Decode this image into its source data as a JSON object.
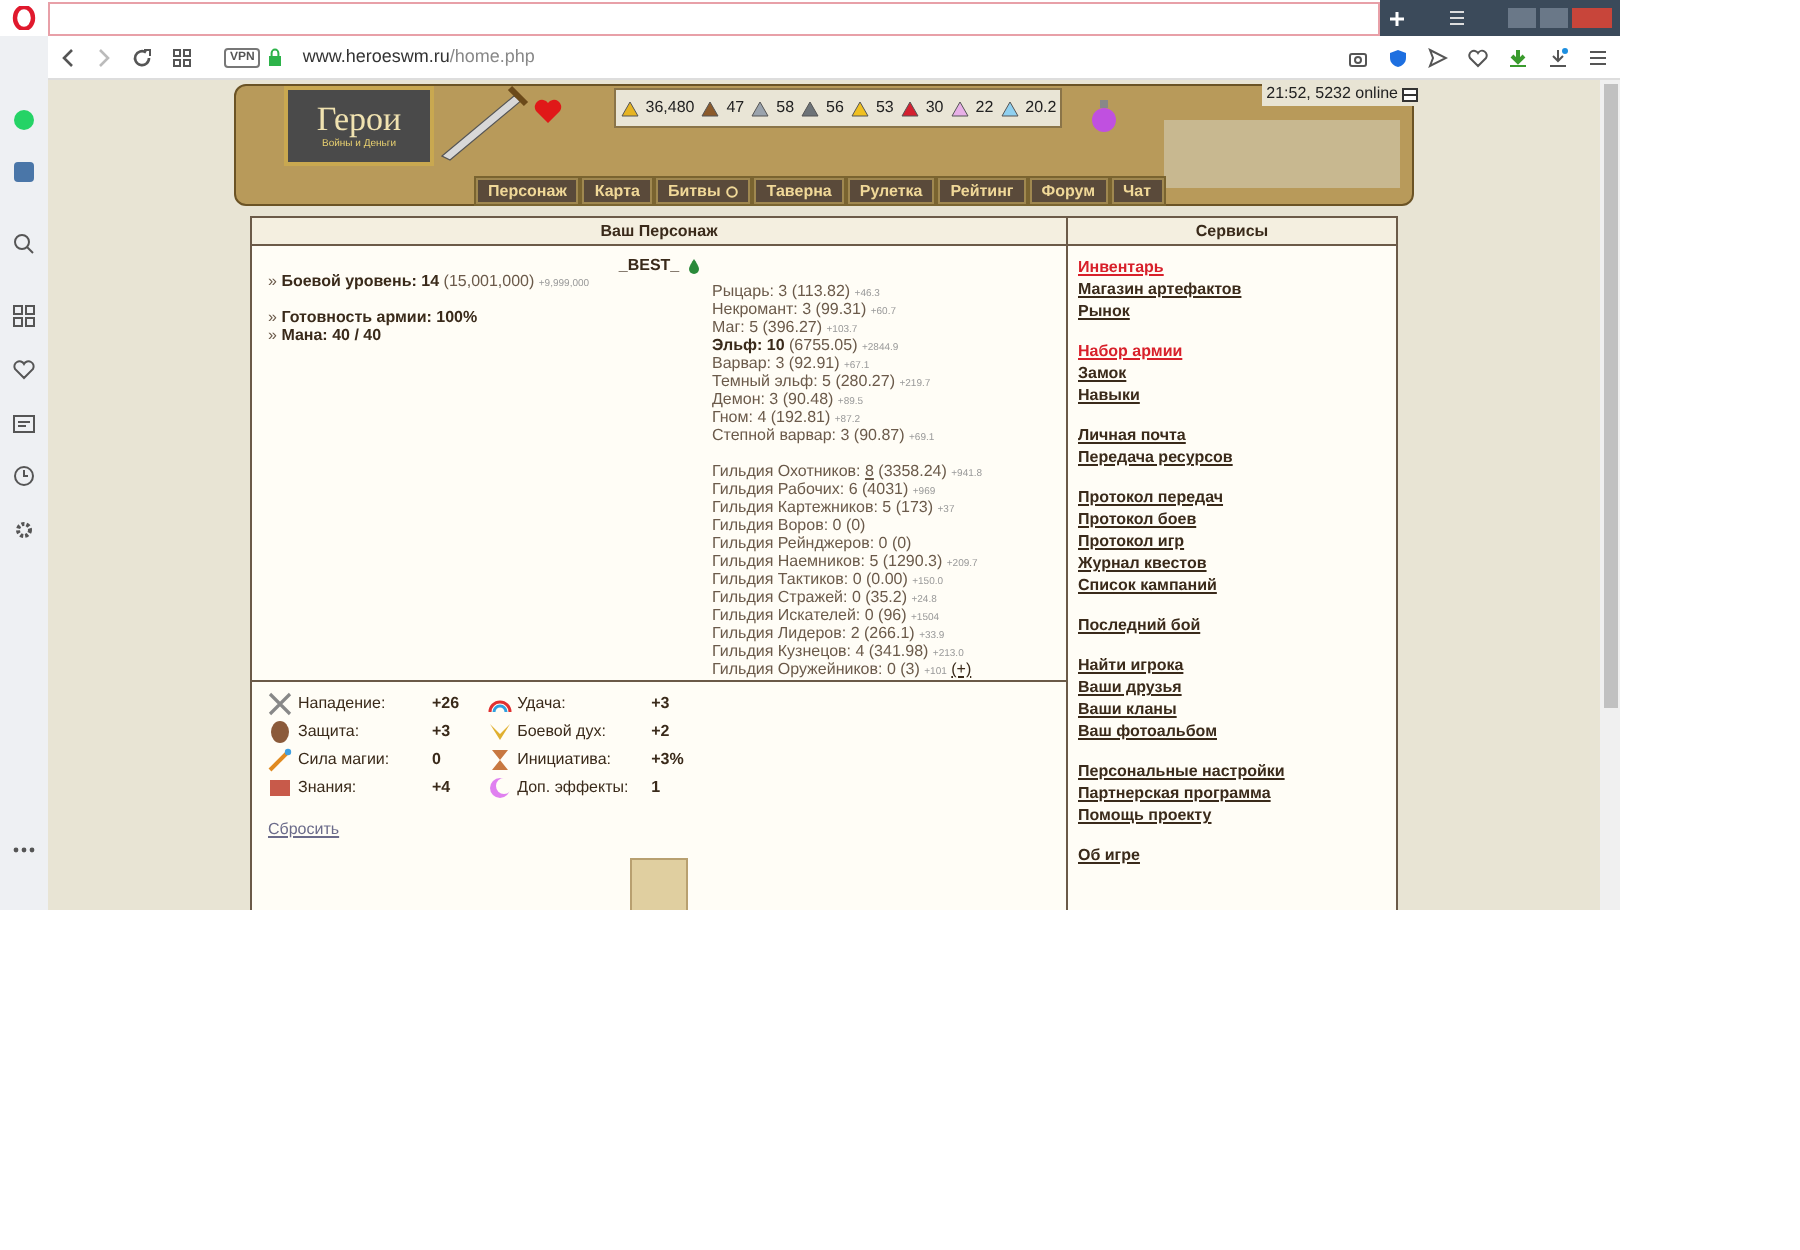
{
  "browser": {
    "vpn": "VPN",
    "url_host": "www.heroeswm.ru",
    "url_path": "/home.php"
  },
  "header": {
    "logo_title": "Герои",
    "logo_subtitle": "Войны и Деньги",
    "resources": [
      "36,480",
      "47",
      "58",
      "56",
      "53",
      "30",
      "22",
      "20.2"
    ],
    "status": "21:52, 5232 online",
    "nav": [
      {
        "label": "Персонаж"
      },
      {
        "label": "Карта"
      },
      {
        "label": "Битвы",
        "badge": true
      },
      {
        "label": "Таверна"
      },
      {
        "label": "Рулетка"
      },
      {
        "label": "Рейтинг"
      },
      {
        "label": "Форум"
      },
      {
        "label": "Чат"
      }
    ]
  },
  "character": {
    "heading": "Ваш Персонаж",
    "name": "_BEST_",
    "stat_groups": [
      [
        {
          "marker": "»",
          "label": "Боевой уровень:",
          "value": "14",
          "detail": "(15,001,000)",
          "delta": "+9,999,000"
        }
      ],
      [
        {
          "marker": "»",
          "label": "Готовность армии:",
          "value": "100%"
        },
        {
          "marker": "»",
          "label": "Мана:",
          "value": "40 / 40"
        }
      ]
    ],
    "factions": [
      {
        "label": "Рыцарь:",
        "value": "3 (113.82)",
        "delta": "+46.3",
        "active": false
      },
      {
        "label": "Некромант:",
        "value": "3 (99.31)",
        "delta": "+60.7",
        "active": false
      },
      {
        "label": "Маг:",
        "value": "5 (396.27)",
        "delta": "+103.7",
        "active": false
      },
      {
        "label": "Эльф:",
        "value": "10",
        "detail": "(6755.05)",
        "delta": "+2844.9",
        "active": true
      },
      {
        "label": "Варвар:",
        "value": "3 (92.91)",
        "delta": "+67.1",
        "active": false
      },
      {
        "label": "Темный эльф:",
        "value": "5 (280.27)",
        "delta": "+219.7",
        "active": false
      },
      {
        "label": "Демон:",
        "value": "3 (90.48)",
        "delta": "+89.5",
        "active": false
      },
      {
        "label": "Гном:",
        "value": "4 (192.81)",
        "delta": "+87.2",
        "active": false
      },
      {
        "label": "Степной варвар:",
        "value": "3 (90.87)",
        "delta": "+69.1",
        "active": false
      }
    ],
    "guilds": [
      {
        "label": "Гильдия Охотников:",
        "level": "8",
        "score": "(3358.24)",
        "delta": "+941.8",
        "link": true
      },
      {
        "label": "Гильдия Рабочих:",
        "level": "6",
        "score": "(4031)",
        "delta": "+969"
      },
      {
        "label": "Гильдия Картежников:",
        "level": "5",
        "score": "(173)",
        "delta": "+37"
      },
      {
        "label": "Гильдия Воров:",
        "level": "0",
        "score": "(0)"
      },
      {
        "label": "Гильдия Рейнджеров:",
        "level": "0",
        "score": "(0)"
      },
      {
        "label": "Гильдия Наемников:",
        "level": "5",
        "score": "(1290.3)",
        "delta": "+209.7"
      },
      {
        "label": "Гильдия Тактиков:",
        "level": "0",
        "score": "(0.00)",
        "delta": "+150.0"
      },
      {
        "label": "Гильдия Стражей:",
        "level": "0",
        "score": "(35.2)",
        "delta": "+24.8"
      },
      {
        "label": "Гильдия Искателей:",
        "level": "0",
        "score": "(96)",
        "delta": "+1504"
      },
      {
        "label": "Гильдия Лидеров:",
        "level": "2",
        "score": "(266.1)",
        "delta": "+33.9"
      },
      {
        "label": "Гильдия Кузнецов:",
        "level": "4",
        "score": "(341.98)",
        "delta": "+213.0"
      },
      {
        "label": "Гильдия Оружейников:",
        "level": "0",
        "score": "(3)",
        "delta": "+101",
        "action": "(+)"
      }
    ],
    "attributes": [
      {
        "label": "Нападение:",
        "value": "+26"
      },
      {
        "label": "Защита:",
        "value": "+3"
      },
      {
        "label": "Сила магии:",
        "value": "0"
      },
      {
        "label": "Знания:",
        "value": "+4"
      },
      {
        "label": "Удача:",
        "value": "+3"
      },
      {
        "label": "Боевой дух:",
        "value": "+2"
      },
      {
        "label": "Инициатива:",
        "value": "+3%"
      },
      {
        "label": "Доп. эффекты:",
        "value": "1"
      }
    ],
    "reset": "Сбросить"
  },
  "services": {
    "heading": "Сервисы",
    "groups": [
      [
        {
          "label": "Инвентарь",
          "highlighted": true
        },
        {
          "label": "Магазин артефактов",
          "highlighted": false
        },
        {
          "label": "Рынок",
          "highlighted": false
        }
      ],
      [
        {
          "label": "Набор армии",
          "highlighted": true
        },
        {
          "label": "Замок",
          "highlighted": false
        },
        {
          "label": "Навыки",
          "highlighted": false
        }
      ],
      [
        {
          "label": "Личная почта",
          "highlighted": false
        },
        {
          "label": "Передача ресурсов",
          "highlighted": false
        }
      ],
      [
        {
          "label": "Протокол передач",
          "highlighted": false
        },
        {
          "label": "Протокол боев",
          "highlighted": false
        },
        {
          "label": "Протокол игр",
          "highlighted": false
        },
        {
          "label": "Журнал квестов",
          "highlighted": false
        },
        {
          "label": "Список кампаний",
          "highlighted": false
        }
      ],
      [
        {
          "label": "Последний бой",
          "highlighted": false
        }
      ],
      [
        {
          "label": "Найти игрока",
          "highlighted": false
        },
        {
          "label": "Ваши друзья",
          "highlighted": false
        },
        {
          "label": "Ваши кланы",
          "highlighted": false
        },
        {
          "label": "Ваш фотоальбом",
          "highlighted": false
        }
      ],
      [
        {
          "label": "Персональные настройки",
          "highlighted": false
        },
        {
          "label": "Партнерская программа",
          "highlighted": false
        },
        {
          "label": "Помощь проекту",
          "highlighted": false
        }
      ],
      [
        {
          "label": "Об игре",
          "highlighted": false
        }
      ]
    ]
  }
}
